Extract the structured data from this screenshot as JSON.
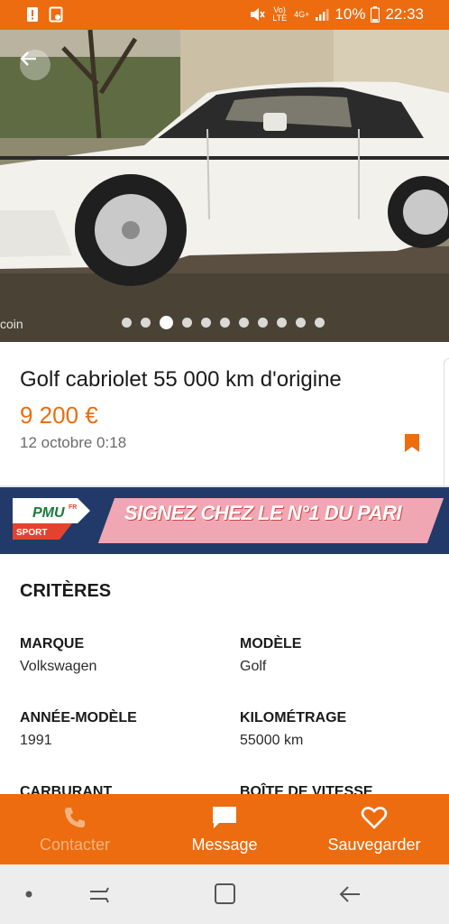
{
  "status_bar": {
    "signal_text": "Vo) LTE",
    "net_text": "4G+",
    "battery": "10%",
    "time": "22:33"
  },
  "gallery": {
    "watermark": "coin",
    "image_count": 11,
    "active_index": 2
  },
  "listing": {
    "title": "Golf cabriolet 55 000 km d'origine",
    "price": "9 200 €",
    "date": "12 octobre 0:18"
  },
  "ad": {
    "brand": "PMU",
    "brand_suffix": "FR",
    "brand_tag": "SPORT",
    "slogan": "SIGNEZ CHEZ LE N°1 DU PARI"
  },
  "criteria": {
    "heading": "CRITÈRES",
    "items": [
      {
        "label": "MARQUE",
        "value": "Volkswagen"
      },
      {
        "label": "MODÈLE",
        "value": "Golf"
      },
      {
        "label": "ANNÉE-MODÈLE",
        "value": "1991"
      },
      {
        "label": "KILOMÉTRAGE",
        "value": "55000 km"
      },
      {
        "label": "CARBURANT",
        "value": ""
      },
      {
        "label": "BOÎTE DE VITESSE",
        "value": ""
      }
    ]
  },
  "actions": {
    "contact": "Contacter",
    "message": "Message",
    "save": "Sauvegarder"
  },
  "colors": {
    "brand_orange": "#ec6c0f",
    "disabled_text": "#f5b37f"
  }
}
